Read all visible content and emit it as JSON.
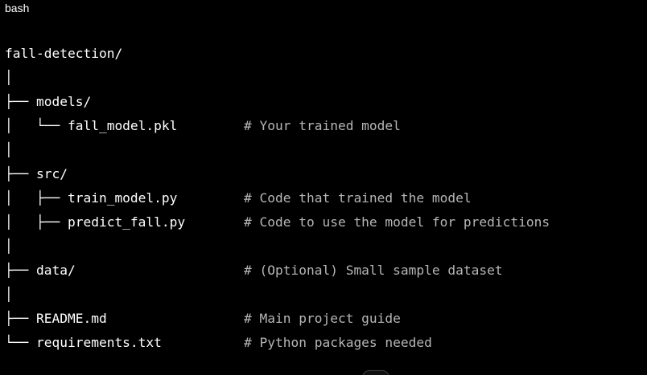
{
  "code_block": {
    "language": "bash",
    "lines": [
      {
        "text": "fall-detection/",
        "comment": ""
      },
      {
        "text": "│",
        "comment": ""
      },
      {
        "text": "├── models/",
        "comment": ""
      },
      {
        "text": "│   └── fall_model.pkl",
        "comment": "# Your trained model"
      },
      {
        "text": "│",
        "comment": ""
      },
      {
        "text": "├── src/",
        "comment": ""
      },
      {
        "text": "│   ├── train_model.py",
        "comment": "# Code that trained the model"
      },
      {
        "text": "│   ├── predict_fall.py",
        "comment": "# Code to use the model for predictions"
      },
      {
        "text": "│",
        "comment": ""
      },
      {
        "text": "├── data/",
        "comment": "# (Optional) Small sample dataset"
      },
      {
        "text": "│",
        "comment": ""
      },
      {
        "text": "├── README.md",
        "comment": "# Main project guide"
      },
      {
        "text": "└── requirements.txt",
        "comment": "# Python packages needed"
      }
    ]
  }
}
